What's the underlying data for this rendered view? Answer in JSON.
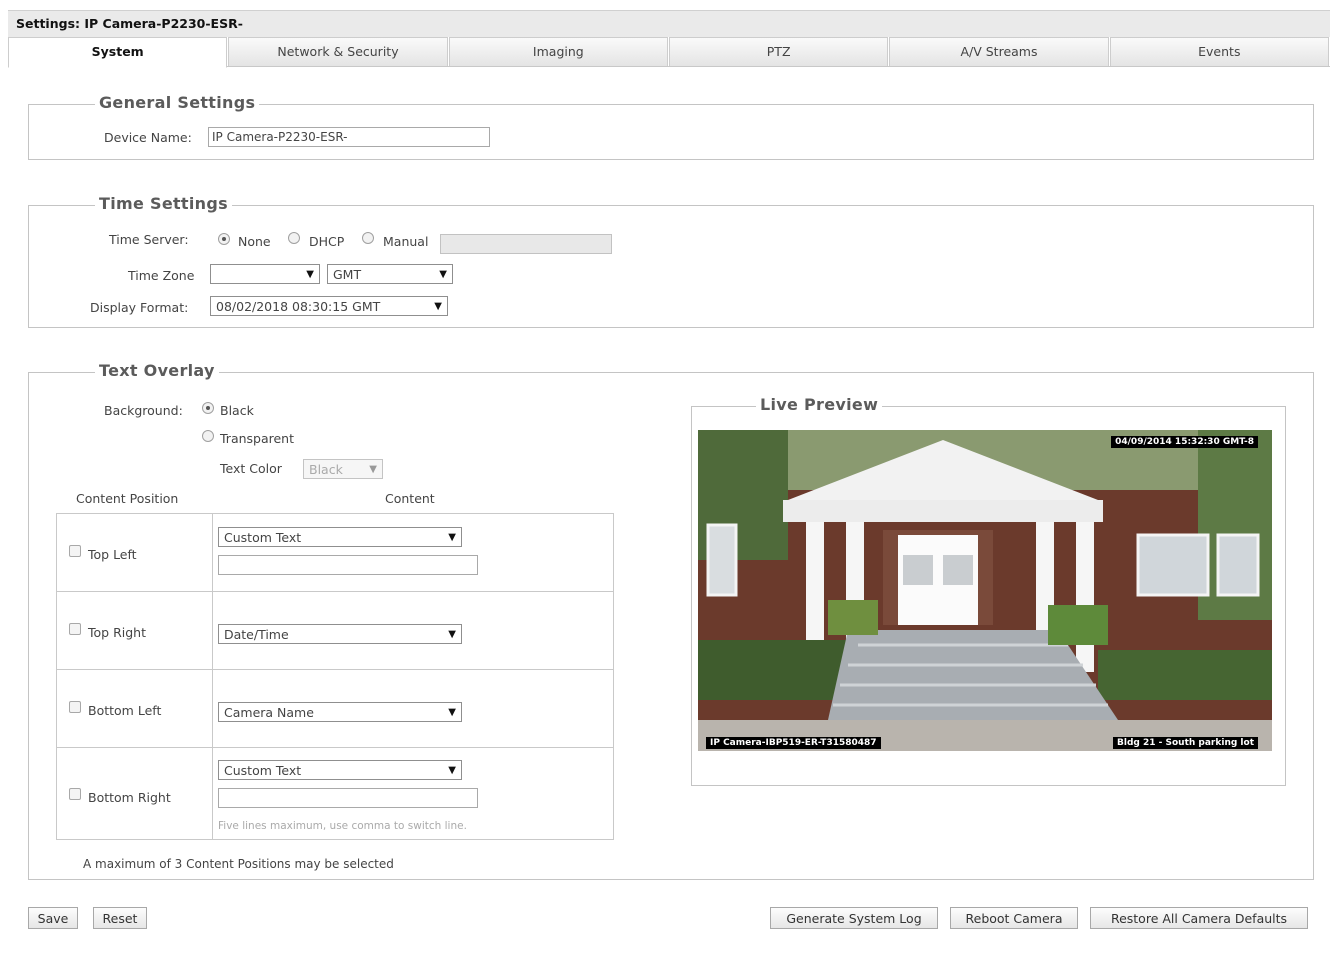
{
  "window": {
    "title": "Settings: IP Camera-P2230-ESR-"
  },
  "tabs": [
    {
      "label": "System",
      "active": true
    },
    {
      "label": "Network & Security"
    },
    {
      "label": "Imaging"
    },
    {
      "label": "PTZ"
    },
    {
      "label": "A/V Streams"
    },
    {
      "label": "Events"
    }
  ],
  "general": {
    "legend": "General Settings",
    "device_name_label": "Device Name:",
    "device_name_value": "IP Camera-P2230-ESR-"
  },
  "time": {
    "legend": "Time Settings",
    "server_label": "Time Server:",
    "server_options": [
      "None",
      "DHCP",
      "Manual"
    ],
    "server_selected": "None",
    "manual_value": "",
    "zone_label": "Time Zone",
    "zone_value": "",
    "zone_gmt": "GMT",
    "format_label": "Display Format:",
    "format_value": "08/02/2018 08:30:15 GMT"
  },
  "overlay": {
    "legend": "Text Overlay",
    "background_label": "Background:",
    "background_options": [
      "Black",
      "Transparent"
    ],
    "background_selected": "Black",
    "text_color_label": "Text Color",
    "text_color_value": "Black",
    "col_position": "Content Position",
    "col_content": "Content",
    "rows": [
      {
        "position": "Top Left",
        "content": "Custom Text",
        "text": ""
      },
      {
        "position": "Top Right",
        "content": "Date/Time"
      },
      {
        "position": "Bottom Left",
        "content": "Camera Name"
      },
      {
        "position": "Bottom Right",
        "content": "Custom Text",
        "text": "",
        "hint": "Five lines maximum, use comma to switch line."
      }
    ],
    "note": "A maximum of 3 Content Positions may be selected"
  },
  "preview": {
    "legend": "Live Preview",
    "timestamp": "04/09/2014 15:32:30 GMT-8",
    "camera_label": "IP Camera-IBP519-ER-T31580487",
    "location_label": "Bldg 21 - South parking lot"
  },
  "buttons": {
    "save": "Save",
    "reset": "Reset",
    "gen_log": "Generate System Log",
    "reboot": "Reboot Camera",
    "restore": "Restore All Camera Defaults"
  },
  "colors": {
    "panel_border": "#c4c4c4",
    "legend_text": "#5b5b5b",
    "tab_bg": "#e4e4e4"
  }
}
